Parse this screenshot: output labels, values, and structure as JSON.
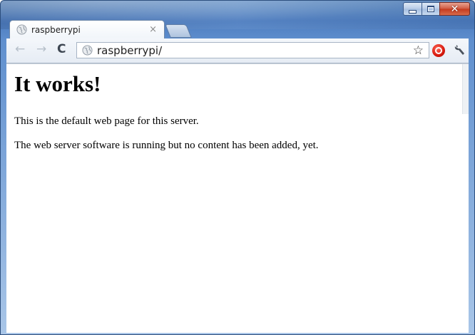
{
  "tab": {
    "title": "raspberrypi",
    "close_glyph": "×",
    "icon": "globe-icon"
  },
  "toolbar": {
    "back_glyph": "←",
    "forward_glyph": "→",
    "reload_glyph": "C",
    "url": "raspberrypi/",
    "star_glyph": "☆"
  },
  "window_controls": {
    "close_glyph": "✕"
  },
  "page": {
    "heading": "It works!",
    "paragraphs": [
      "This is the default web page for this server.",
      "The web server software is running but no content has been added, yet."
    ]
  },
  "colors": {
    "titlebar": "#4c7cbf",
    "close_button": "#c5391c",
    "stop_extension": "#d8190d"
  }
}
